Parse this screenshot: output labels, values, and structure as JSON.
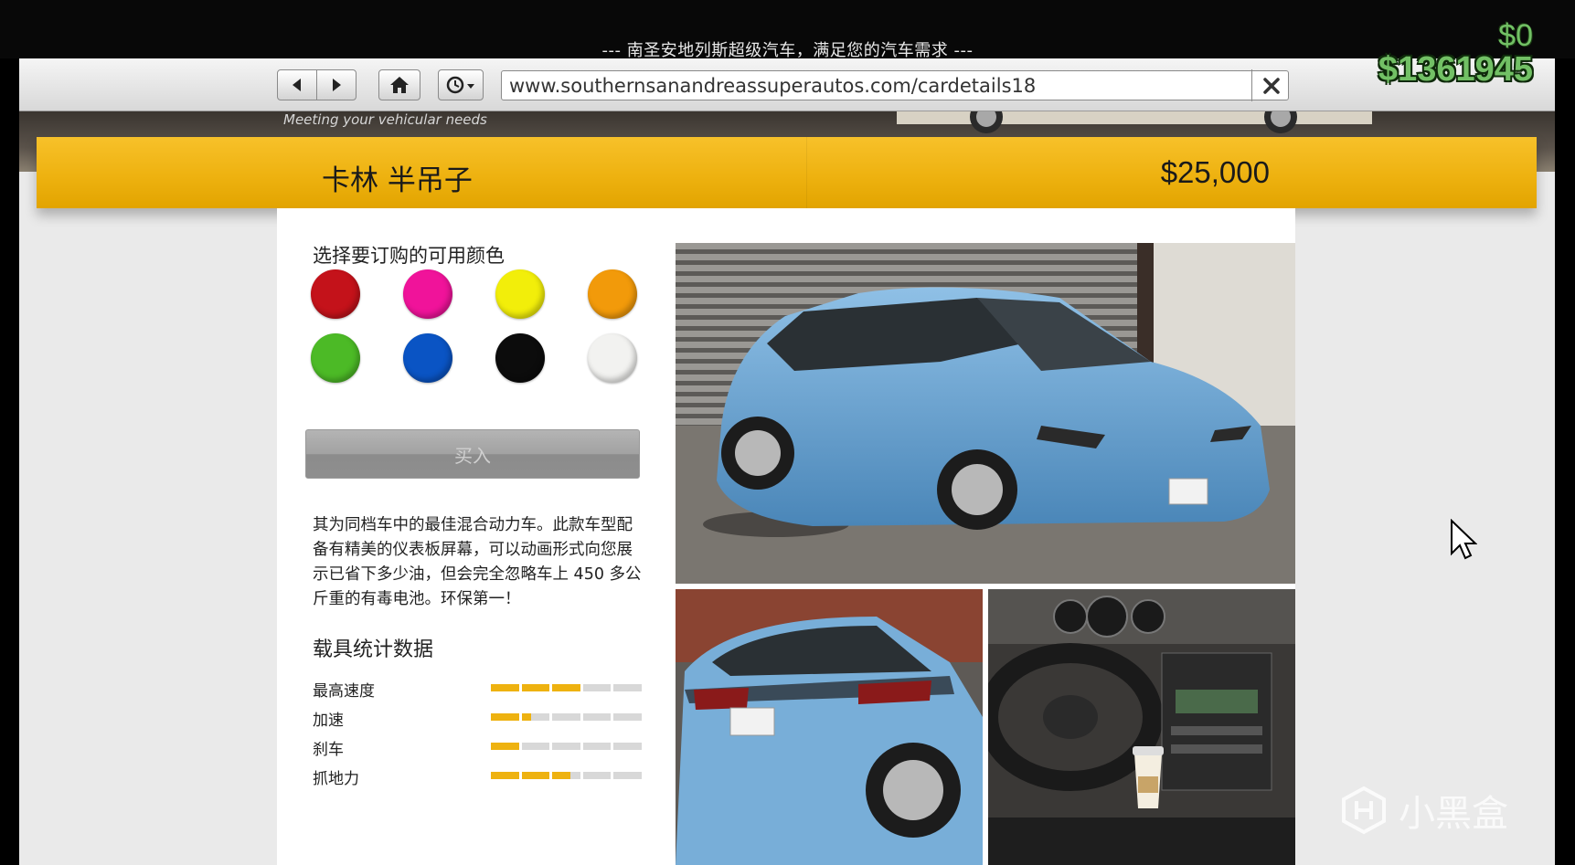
{
  "window": {
    "title": "--- 南圣安地列斯超级汽车，满足您的汽车需求 ---"
  },
  "hud": {
    "cash": "$0",
    "bank": "$1361945"
  },
  "browser": {
    "url": "www.southernsanandreassuperautos.com/cardetails18",
    "back_icon": "back-arrow-icon",
    "forward_icon": "forward-arrow-icon",
    "home_icon": "home-icon",
    "history_icon": "clock-icon",
    "close_icon": "close-icon"
  },
  "banner": {
    "tagline": "Meeting your vehicular needs"
  },
  "vehicle": {
    "name": "卡林 半吊子",
    "price": "$25,000",
    "description": "其为同档车中的最佳混合动力车。此款车型配备有精美的仪表板屏幕，可以动画形式向您展示已省下多少油，但会完全忽略车上 450 多公斤重的有毒电池。环保第一！"
  },
  "colors": {
    "heading": "选择要订购的可用颜色",
    "swatches": [
      "#c4121a",
      "#f0139a",
      "#f2ee0a",
      "#f29a0a",
      "#4cba26",
      "#0a54c4",
      "#0c0c0c",
      "#f2f2f0"
    ]
  },
  "buy": {
    "label": "买入"
  },
  "stats": {
    "heading": "载具统计数据",
    "items": [
      {
        "label": "最高速度",
        "value": 0.6
      },
      {
        "label": "加速",
        "value": 0.27
      },
      {
        "label": "刹车",
        "value": 0.2
      },
      {
        "label": "抓地力",
        "value": 0.53
      }
    ]
  },
  "photos": {
    "body_color": "#6aa4d4"
  },
  "watermark": {
    "text": "小黑盒"
  }
}
